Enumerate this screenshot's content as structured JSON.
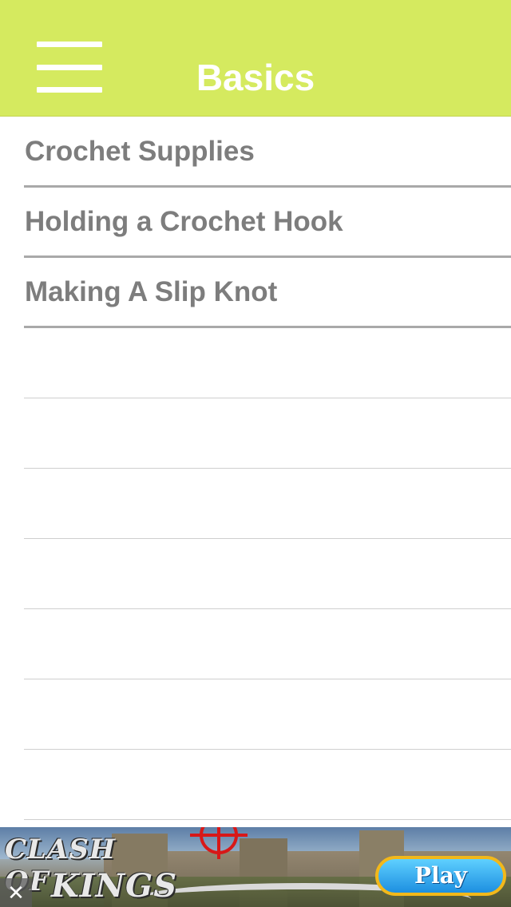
{
  "header": {
    "title": "Basics",
    "menu_icon": "hamburger-menu-icon",
    "background_color": "#d5ea5f",
    "title_color": "#ffffff"
  },
  "list": {
    "items": [
      {
        "label": "Crochet Supplies"
      },
      {
        "label": "Holding a Crochet Hook"
      },
      {
        "label": "Making A Slip Knot"
      },
      {
        "label": ""
      },
      {
        "label": ""
      },
      {
        "label": ""
      },
      {
        "label": ""
      },
      {
        "label": ""
      },
      {
        "label": ""
      },
      {
        "label": ""
      }
    ],
    "text_color": "#7d7d7d"
  },
  "ad": {
    "logo_line1": "CLASH OF",
    "logo_line2": "KINGS",
    "play_label": "Play",
    "close_label": "✕"
  }
}
